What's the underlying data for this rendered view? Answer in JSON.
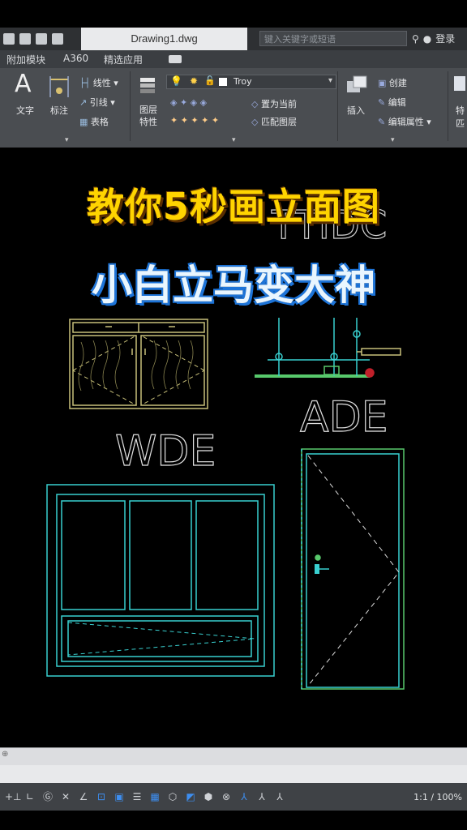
{
  "window": {
    "doc_tab": "Drawing1.dwg",
    "search_placeholder": "键入关键字或短语",
    "login_label": "登录"
  },
  "ribbon_tabs": [
    "附加模块",
    "A360",
    "精选应用"
  ],
  "ribbon": {
    "text_label": "文字",
    "dim_label": "标注",
    "linetype_label": "线性",
    "leader_label": "引线",
    "table_label": "表格",
    "layer_props_label": "图层\n特性",
    "layer_name": "Troy",
    "set_current_label": "置为当前",
    "match_layer_label": "匹配图层",
    "insert_label": "插入",
    "create_label": "创建",
    "edit_label": "编辑",
    "edit_attr_label": "编辑属性",
    "right_label_1": "特",
    "right_label_2": "匹"
  },
  "canvas": {
    "headline": "教你5秒画立面图",
    "subheadline": "小白立马变大神",
    "top_fragment": "TTIDC",
    "label_ade": "ADE",
    "label_wde": "WDE"
  },
  "statusbar": {
    "zoom": "1:1 / 100%"
  },
  "colors": {
    "headline": "#ffd400",
    "subheadline_outline": "#1d74d8",
    "cad_cyan": "#39d0d0",
    "cad_yellow": "#c8c07a"
  }
}
